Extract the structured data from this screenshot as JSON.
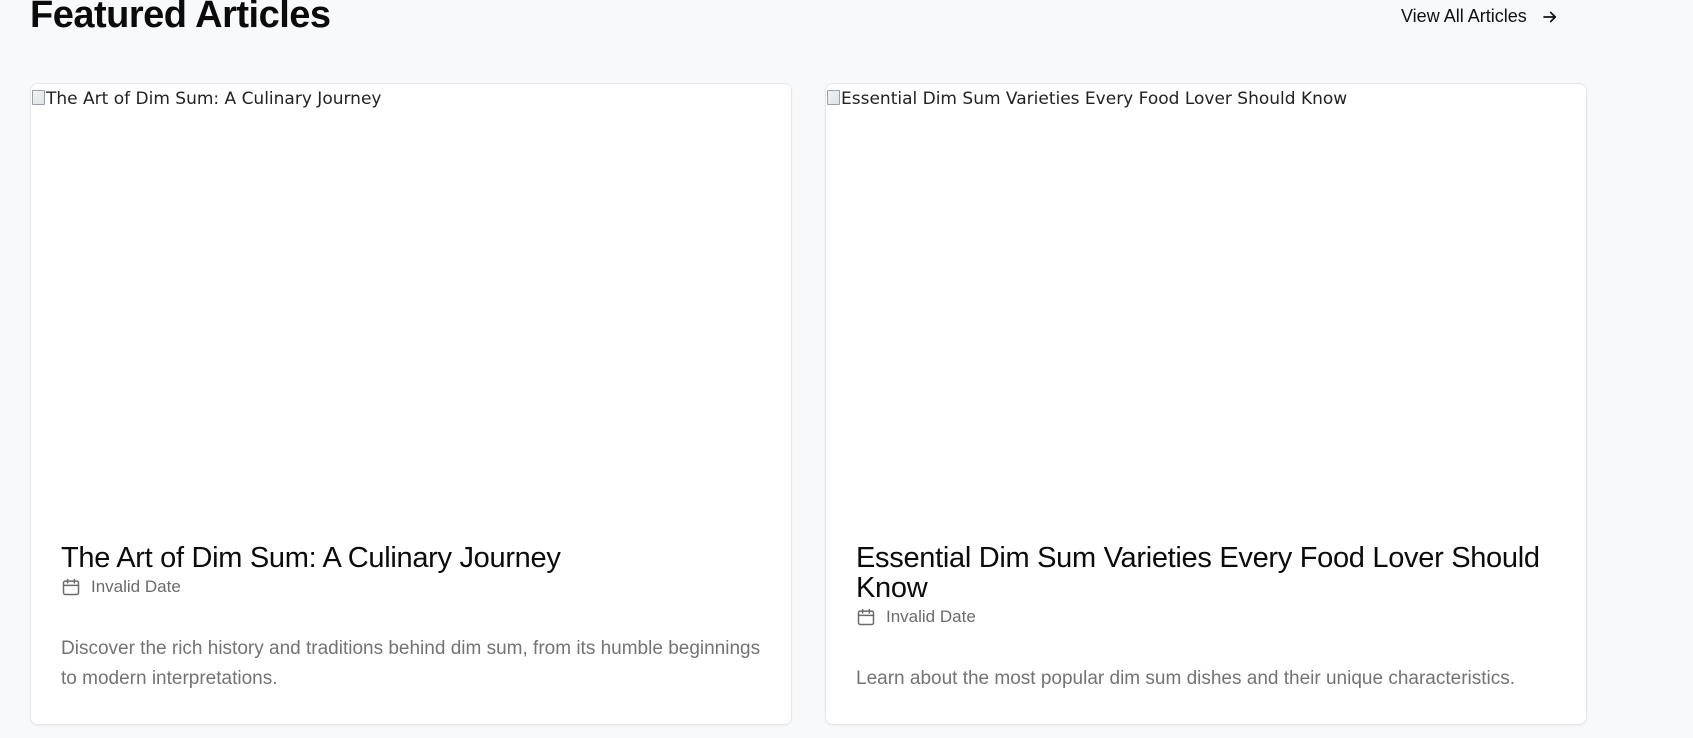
{
  "section": {
    "title": "Featured Articles",
    "view_all_label": "View All Articles",
    "view_all_icon": "arrow-right-icon"
  },
  "articles": [
    {
      "image_alt": "The Art of Dim Sum: A Culinary Journey",
      "title": "The Art of Dim Sum: A Culinary Journey",
      "date_icon": "calendar-icon",
      "date": "Invalid Date",
      "excerpt": "Discover the rich history and traditions behind dim sum, from its humble beginnings to modern interpretations."
    },
    {
      "image_alt": "Essential Dim Sum Varieties Every Food Lover Should Know",
      "title": "Essential Dim Sum Varieties Every Food Lover Should Know",
      "date_icon": "calendar-icon",
      "date": "Invalid Date",
      "excerpt": "Learn about the most popular dim sum dishes and their unique characteristics."
    }
  ],
  "colors": {
    "background": "#f8f9fb",
    "card": "#ffffff",
    "text_primary": "#0b0b0b",
    "text_muted": "#737373"
  }
}
